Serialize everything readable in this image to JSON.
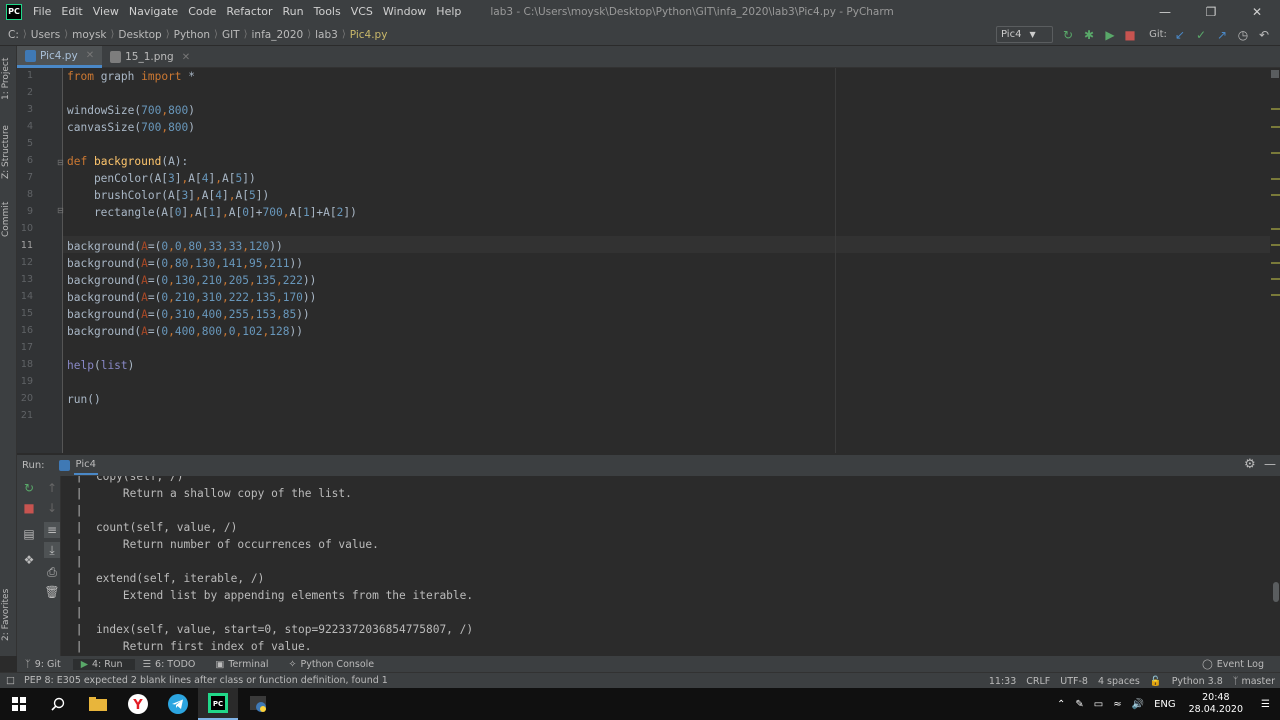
{
  "titlebar": {
    "logo": "PC",
    "menu": [
      "File",
      "Edit",
      "View",
      "Navigate",
      "Code",
      "Refactor",
      "Run",
      "Tools",
      "VCS",
      "Window",
      "Help"
    ],
    "title": "lab3 - C:\\Users\\moysk\\Desktop\\Python\\GIT\\infa_2020\\lab3\\Pic4.py - PyCharm"
  },
  "breadcrumbs": [
    "C:",
    "Users",
    "moysk",
    "Desktop",
    "Python",
    "GIT",
    "infa_2020",
    "lab3",
    "Pic4.py"
  ],
  "toolbar": {
    "run_config": "Pic4",
    "git_label": "Git:"
  },
  "left_tool_tabs": [
    "1: Project",
    "Z: Structure",
    "Commit",
    "2: Favorites"
  ],
  "tabs": [
    {
      "label": "Pic4.py",
      "active": true
    },
    {
      "label": "15_1.png",
      "active": false
    }
  ],
  "editor": {
    "line_numbers": [
      "1",
      "2",
      "3",
      "4",
      "5",
      "6",
      "7",
      "8",
      "9",
      "10",
      "11",
      "12",
      "13",
      "14",
      "15",
      "16",
      "17",
      "18",
      "19",
      "20",
      "21"
    ],
    "current_line": "11"
  },
  "run_panel": {
    "label": "Run:",
    "config": "Pic4",
    "output": [
      " |  copy(self, /)",
      " |      Return a shallow copy of the list.",
      " |",
      " |  count(self, value, /)",
      " |      Return number of occurrences of value.",
      " |",
      " |  extend(self, iterable, /)",
      " |      Extend list by appending elements from the iterable.",
      " |",
      " |  index(self, value, start=0, stop=9223372036854775807, /)",
      " |      Return first index of value."
    ]
  },
  "bottom_tools": [
    "9: Git",
    "4: Run",
    "6: TODO",
    "Terminal",
    "Python Console"
  ],
  "event_log": "Event Log",
  "status": {
    "message": "PEP 8: E305 expected 2 blank lines after class or function definition, found 1",
    "position": "11:33",
    "line_sep": "CRLF",
    "encoding": "UTF-8",
    "indent": "4 spaces",
    "interpreter": "Python 3.8",
    "branch": "master"
  },
  "taskbar": {
    "lang": "ENG",
    "time": "20:48",
    "date": "28.04.2020"
  },
  "colors": {
    "keyword": "#cc7832",
    "number": "#6897bb",
    "function": "#ffc66d",
    "param": "#aa4926",
    "builtin": "#8888c6",
    "text": "#a9b7c6"
  }
}
